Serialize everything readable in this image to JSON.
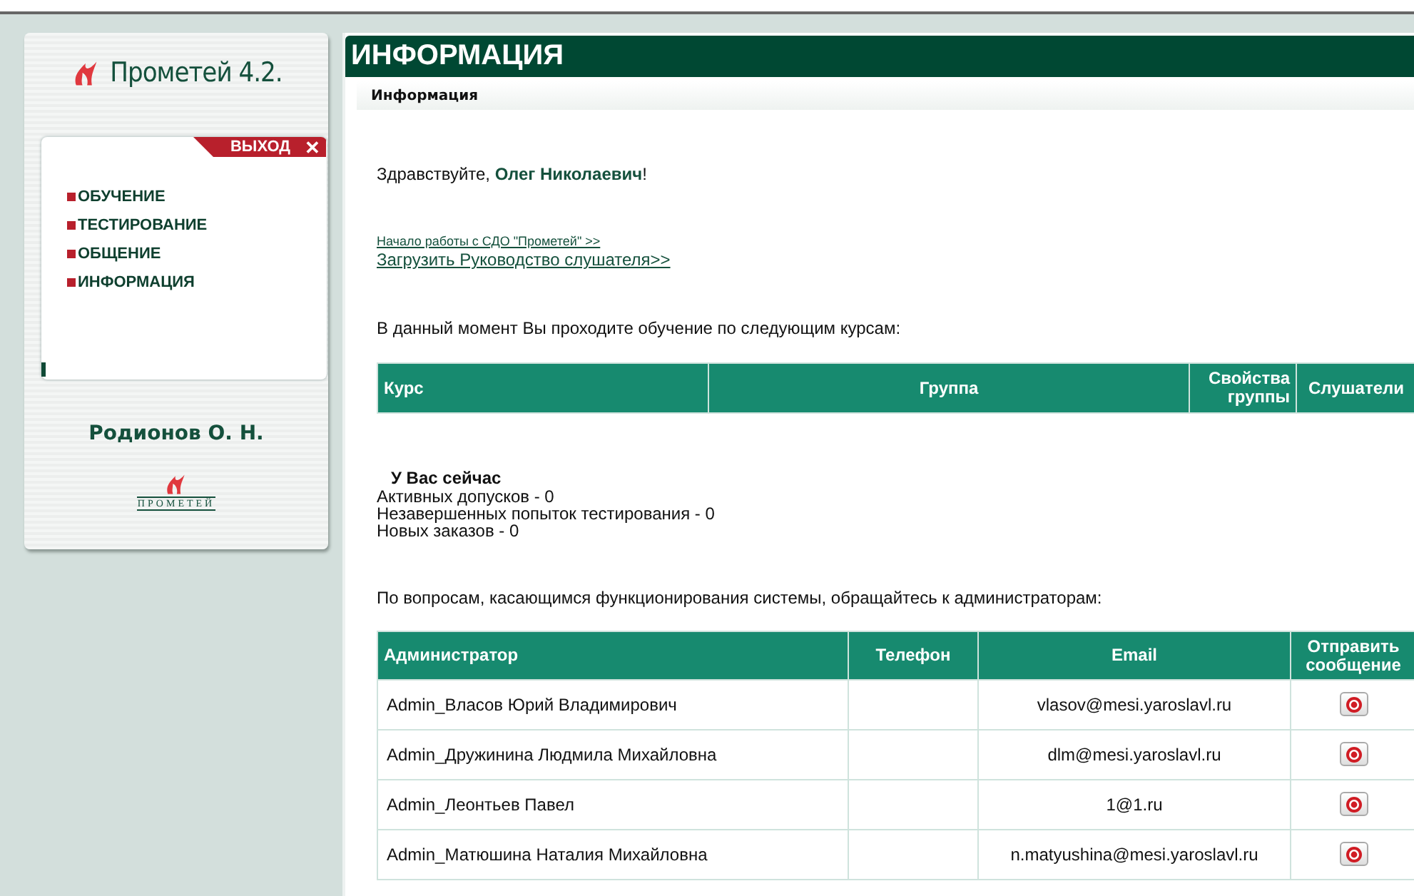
{
  "sidebar": {
    "logo_title": "Прометей 4.2.",
    "exit_label": "ВЫХОД",
    "exit_icon": "✕",
    "menu": [
      {
        "label": "ОБУЧЕНИЕ"
      },
      {
        "label": "ТЕСТИРОВАНИЕ"
      },
      {
        "label": "ОБЩЕНИЕ"
      },
      {
        "label": "ИНФОРМАЦИЯ"
      }
    ],
    "user_name": "Родионов О. Н.",
    "footer_logo_text": "ПРОМЕТЕЙ"
  },
  "page": {
    "title": "ИНФОРМАЦИЯ",
    "breadcrumb": "Информация",
    "greeting": "Здравствуйте, **Олег Николаевич**!",
    "links": [
      {
        "label": "Начало работы с СДО \"Прометей\" >>",
        "kind": "small"
      },
      {
        "label": "Загрузить Руководство слушателя>>",
        "kind": "normal"
      }
    ],
    "courses_intro": "В данный момент Вы проходите обучение по следующим курсам:",
    "courses_table": {
      "columns": [
        "Курс",
        "Группа",
        "Свойства группы",
        "Слушатели"
      ]
    },
    "status_title": "У Вас сейчас",
    "status_lines": [
      "Активных допусков - 0",
      "Незавершенных попыток тестирования - 0",
      "Новых заказов - 0"
    ],
    "admins_intro": "По вопросам, касающимся функционирования системы, обращайтесь к администраторам:",
    "admins_table": {
      "columns": [
        "Администратор",
        "Телефон",
        "Email",
        "Отправить сообщение"
      ],
      "rows": [
        {
          "name": "Admin_Власов Юрий Владимирович",
          "email": "vlasov@mesi.yaroslavl.ru"
        },
        {
          "name": "Admin_Дружинина Людмила Михайловна",
          "email": "dlm@mesi.yaroslavl.ru"
        },
        {
          "name": "Admin_Леонтьев Павел",
          "email": "1@1.ru"
        },
        {
          "name": "Admin_Матюшина Наталия Михайловна",
          "email": "n.matyushina@mesi.yaroslavl.ru"
        }
      ]
    }
  }
}
